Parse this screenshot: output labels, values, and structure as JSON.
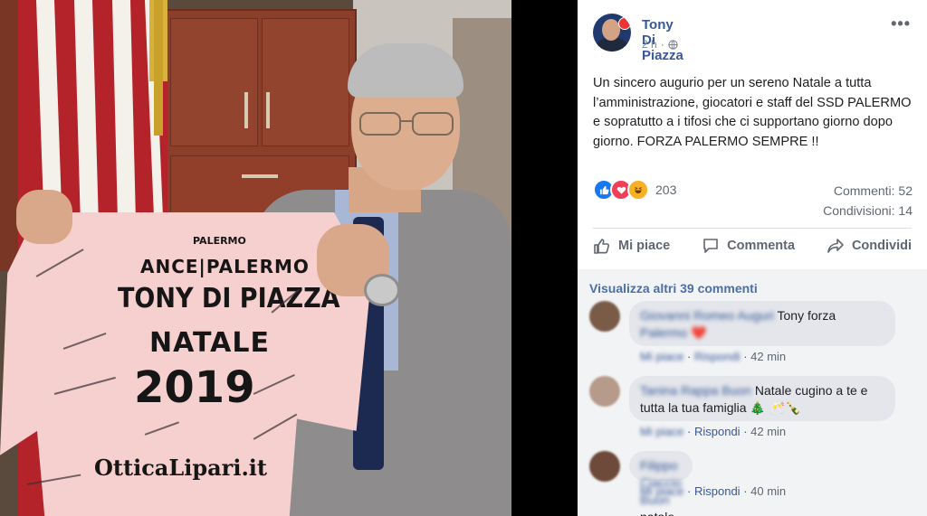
{
  "post": {
    "author": "Tony Di Piazza",
    "time": "2 h",
    "separator": "·",
    "text": "Un sincero augurio per un sereno Natale a tutta l’amministrazione, giocatori e staff del SSD PALERMO e sopratutto a i tifosi che ci supportano giorno dopo giorno. FORZA PALERMO SEMPRE !!",
    "more_label": "•••"
  },
  "photo": {
    "jersey": {
      "brand": "PALERMO",
      "sponsor": "ANCE|PALERMO",
      "name": "TONY DI PIAZZA",
      "line2": "NATALE",
      "year": "2019",
      "bottom_sponsor": "OtticaLipari.it"
    }
  },
  "reactions": {
    "count": "203",
    "icons": [
      "like-icon",
      "love-icon",
      "haha-icon"
    ],
    "comments_label": "Commenti: 52",
    "shares_label": "Condivisioni: 14"
  },
  "actions": {
    "like": "Mi piace",
    "comment": "Commenta",
    "share": "Condividi"
  },
  "comments": {
    "view_more": "Visualizza altri 39 commenti",
    "like_label": "Mi piace",
    "reply_label": "Rispondi",
    "items": [
      {
        "name": "Giovanni Romeo Auguri",
        "text": "Tony forza",
        "text2": "Palermo ❤️",
        "time": "42 min"
      },
      {
        "name": "Tanina Rappa Buon",
        "text": "Natale cugino a te e",
        "text2": "tutta la tua famiglia 🎄 🥂🍾",
        "time": "42 min"
      },
      {
        "name": "Filippo Ciaccio Buon",
        "text": "natale",
        "time": "40 min"
      }
    ]
  },
  "colors": {
    "link": "#385898",
    "accent": "#1877f2",
    "text_secondary": "#606770"
  }
}
